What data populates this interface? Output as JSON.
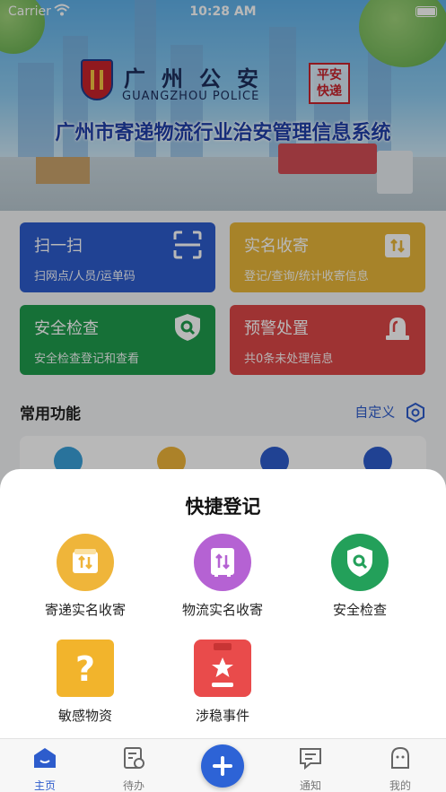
{
  "status_bar": {
    "carrier": "Carrier",
    "time": "10:28 AM"
  },
  "header": {
    "logo_cn": "广州公安",
    "logo_en": "GUANGZHOU POLICE",
    "seal_line1": "平安",
    "seal_line2": "快递",
    "system_title": "广州市寄递物流行业治安管理信息系统"
  },
  "cards": [
    {
      "title": "扫一扫",
      "subtitle": "扫网点/人员/运单码",
      "icon": "scan-icon",
      "color": "#2d5ccc"
    },
    {
      "title": "实名收寄",
      "subtitle": "登记/查询/统计收寄信息",
      "icon": "package-icon",
      "color": "#e8b63a"
    },
    {
      "title": "安全检查",
      "subtitle": "安全检查登记和查看",
      "icon": "shield-search-icon",
      "color": "#1f9b4d"
    },
    {
      "title": "预警处置",
      "subtitle": "共0条未处理信息",
      "icon": "alarm-light-icon",
      "color": "#dc4747"
    }
  ],
  "common": {
    "title": "常用功能",
    "customize": "自定义"
  },
  "sheet": {
    "title": "快捷登记",
    "items": [
      {
        "label": "寄递实名收寄",
        "icon": "package-icon",
        "color": "#efb53a"
      },
      {
        "label": "物流实名收寄",
        "icon": "cargo-icon",
        "color": "#b562d3"
      },
      {
        "label": "安全检查",
        "icon": "shield-search-icon",
        "color": "#23a05a"
      },
      {
        "label": "敏感物资",
        "icon": "question-box-icon",
        "color": "#f2b42c"
      },
      {
        "label": "涉稳事件",
        "icon": "clipboard-star-icon",
        "color": "#e94b4b"
      }
    ]
  },
  "tabs": [
    {
      "label": "主页",
      "icon": "home-icon",
      "active": true
    },
    {
      "label": "待办",
      "icon": "todo-icon",
      "active": false
    },
    {
      "label": "通知",
      "icon": "message-icon",
      "active": false
    },
    {
      "label": "我的",
      "icon": "profile-icon",
      "active": false
    }
  ]
}
